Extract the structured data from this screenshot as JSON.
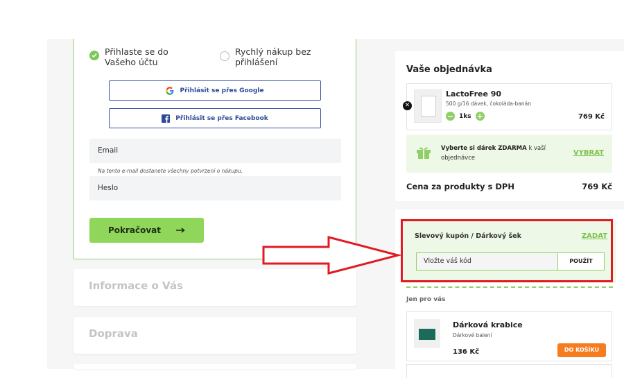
{
  "login": {
    "option_login": "Přihlaste se do Vašeho účtu",
    "option_quick": "Rychlý nákup bez přihlášení",
    "google_btn": "Přihlásit se přes Google",
    "facebook_btn": "Přihlásit se přes Facebook",
    "email_label": "Email",
    "email_hint": "Na tento e-mail dostanete všechny potvrzení o nákupu.",
    "password_label": "Heslo",
    "continue_btn": "Pokračovat"
  },
  "sections": {
    "info": "Informace o Vás",
    "shipping": "Doprava"
  },
  "order": {
    "title": "Vaše objednávka",
    "product": {
      "name": "LactoFree 90",
      "variant": "500 g/16 dávek, čokoláda-banán",
      "qty": "1ks",
      "price": "769 Kč"
    },
    "gift": {
      "text_pre": "Vyberte si dárek ZDARMA",
      "text_post": " k vaší objednávce",
      "link": "VYBRAT"
    },
    "total_label": "Cena za produkty s DPH",
    "total_value": "769 Kč"
  },
  "coupon": {
    "title": "Slevový kupón / Dárkový šek",
    "link": "ZADAT",
    "placeholder": "Vložte váš kód",
    "apply": "POUŽÍT"
  },
  "offers": {
    "label": "Jen pro vás",
    "item": {
      "name": "Dárková krabice",
      "sub": "Dárkové balení",
      "price": "136 Kč",
      "button": "DO KOŠÍKU"
    }
  },
  "colors": {
    "accent_green": "#8fd65b",
    "link_green": "#7cc14b",
    "highlight_red": "#e11b22",
    "cart_orange": "#f57c1f"
  }
}
